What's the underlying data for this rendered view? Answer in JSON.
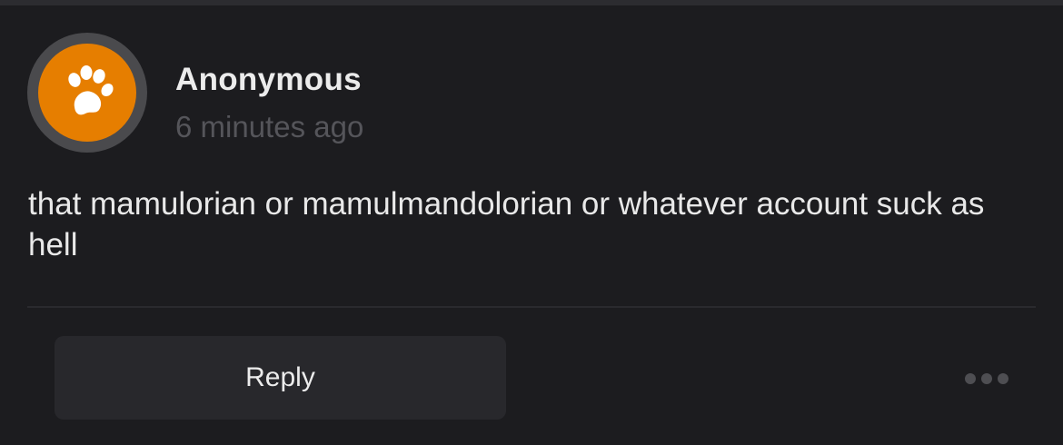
{
  "post": {
    "author": "Anonymous",
    "timestamp": "6 minutes ago",
    "avatar_icon": "paw-icon",
    "avatar_color": "#e67e00",
    "message": "that mamulorian or mamulmandolorian or whatever account suck as hell"
  },
  "actions": {
    "reply_label": "Reply",
    "more_icon": "more-dots-icon"
  }
}
